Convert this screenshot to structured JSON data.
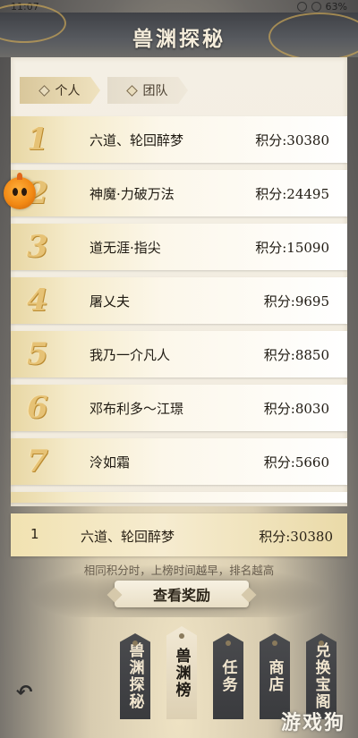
{
  "status": {
    "time": "11:07",
    "battery": "63%"
  },
  "header": {
    "title": "兽渊探秘"
  },
  "tabs": [
    {
      "label": "个人",
      "active": true
    },
    {
      "label": "团队",
      "active": false
    }
  ],
  "leaderboard": [
    {
      "rank": "1",
      "name": "六道、轮回醉梦",
      "score": "积分:30380"
    },
    {
      "rank": "2",
      "name": "神魔·力破万法",
      "score": "积分:24495"
    },
    {
      "rank": "3",
      "name": "道无涯·指尖",
      "score": "积分:15090"
    },
    {
      "rank": "4",
      "name": "屠乂夫",
      "score": "积分:9695"
    },
    {
      "rank": "5",
      "name": "我乃一介凡人",
      "score": "积分:8850"
    },
    {
      "rank": "6",
      "name": "邓布利多～江璟",
      "score": "积分:8030"
    },
    {
      "rank": "7",
      "name": "泠如霜",
      "score": "积分:5660"
    }
  ],
  "my_rank": {
    "rank": "1",
    "name": "六道、轮回醉梦",
    "score": "积分:30380"
  },
  "hint": "相同积分时，上榜时间越早，排名越高",
  "reward_button": "查看奖励",
  "nav_tags": [
    {
      "label": "兽渊探秘",
      "style": "dark"
    },
    {
      "label": "兽渊榜",
      "style": "light"
    },
    {
      "label": "任务",
      "style": "dark"
    },
    {
      "label": "商店",
      "style": "dark"
    },
    {
      "label": "兑换宝阁",
      "style": "dark"
    }
  ],
  "watermark": "游戏狗",
  "colors": {
    "gold": "#e6c275",
    "panel": "#f4efe4",
    "dark_tag": "#4a4b4e",
    "float_icon": "#f28914"
  },
  "icons": {
    "back": "back-arrow-icon",
    "float": "pumpkin-assistant-icon"
  }
}
